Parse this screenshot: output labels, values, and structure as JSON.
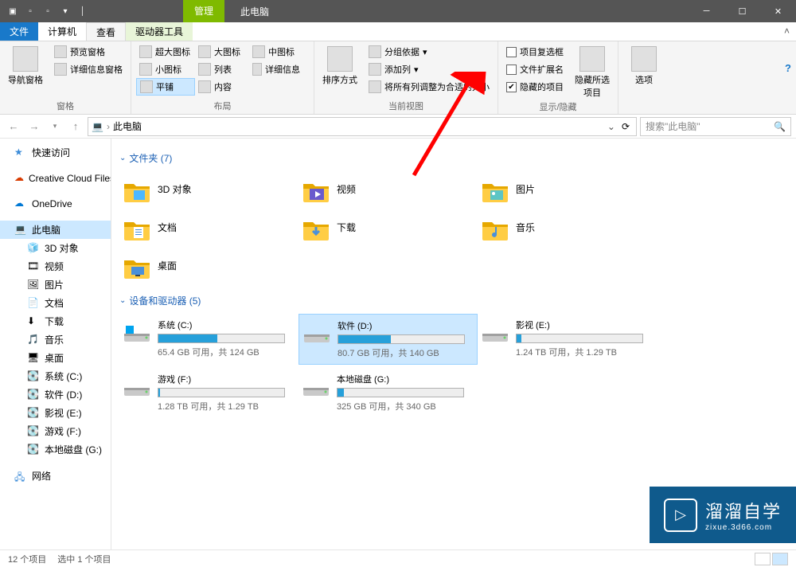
{
  "title": "此电脑",
  "contextual_tab": "管理",
  "tabs": {
    "file": "文件",
    "computer": "计算机",
    "view": "查看",
    "drive_tools": "驱动器工具"
  },
  "ribbon": {
    "panes": {
      "nav_pane": "导航窗格",
      "preview_pane": "预览窗格",
      "details_pane": "详细信息窗格",
      "group_label": "窗格"
    },
    "layout": {
      "extra_large": "超大图标",
      "large": "大图标",
      "medium": "中图标",
      "small": "小图标",
      "list": "列表",
      "details": "详细信息",
      "tiles": "平铺",
      "content": "内容",
      "group_label": "布局"
    },
    "current_view": {
      "sort_by": "排序方式",
      "group_by": "分组依据",
      "add_columns": "添加列",
      "size_all": "将所有列调整为合适的大小",
      "group_label": "当前视图"
    },
    "show_hide": {
      "item_checkboxes": "项目复选框",
      "file_ext": "文件扩展名",
      "hidden_items": "隐藏的项目",
      "hide_selected": "隐藏所选项目",
      "group_label": "显示/隐藏"
    },
    "options": "选项"
  },
  "addressbar": {
    "path": "此电脑",
    "search_placeholder": "搜索\"此电脑\""
  },
  "sidebar": {
    "quick_access": "快速访问",
    "creative_cloud": "Creative Cloud Files",
    "onedrive": "OneDrive",
    "this_pc": "此电脑",
    "items": [
      "3D 对象",
      "视频",
      "图片",
      "文档",
      "下载",
      "音乐",
      "桌面",
      "系统 (C:)",
      "软件 (D:)",
      "影视 (E:)",
      "游戏 (F:)",
      "本地磁盘 (G:)"
    ],
    "network": "网络"
  },
  "groups": {
    "folders": {
      "header": "文件夹 (7)",
      "items": [
        "3D 对象",
        "视频",
        "图片",
        "文档",
        "下载",
        "音乐",
        "桌面"
      ]
    },
    "drives": {
      "header": "设备和驱动器 (5)",
      "items": [
        {
          "name": "系统 (C:)",
          "sub": "65.4 GB 可用，共 124 GB",
          "pct": 47,
          "sel": false,
          "os": true
        },
        {
          "name": "软件 (D:)",
          "sub": "80.7 GB 可用，共 140 GB",
          "pct": 42,
          "sel": true
        },
        {
          "name": "影视 (E:)",
          "sub": "1.24 TB 可用，共 1.29 TB",
          "pct": 4
        },
        {
          "name": "游戏 (F:)",
          "sub": "1.28 TB 可用，共 1.29 TB",
          "pct": 1
        },
        {
          "name": "本地磁盘 (G:)",
          "sub": "325 GB 可用，共 340 GB",
          "pct": 5
        }
      ]
    }
  },
  "statusbar": {
    "count": "12 个项目",
    "selected": "选中 1 个项目"
  },
  "watermark": {
    "big": "溜溜自学",
    "small": "zixue.3d66.com"
  }
}
